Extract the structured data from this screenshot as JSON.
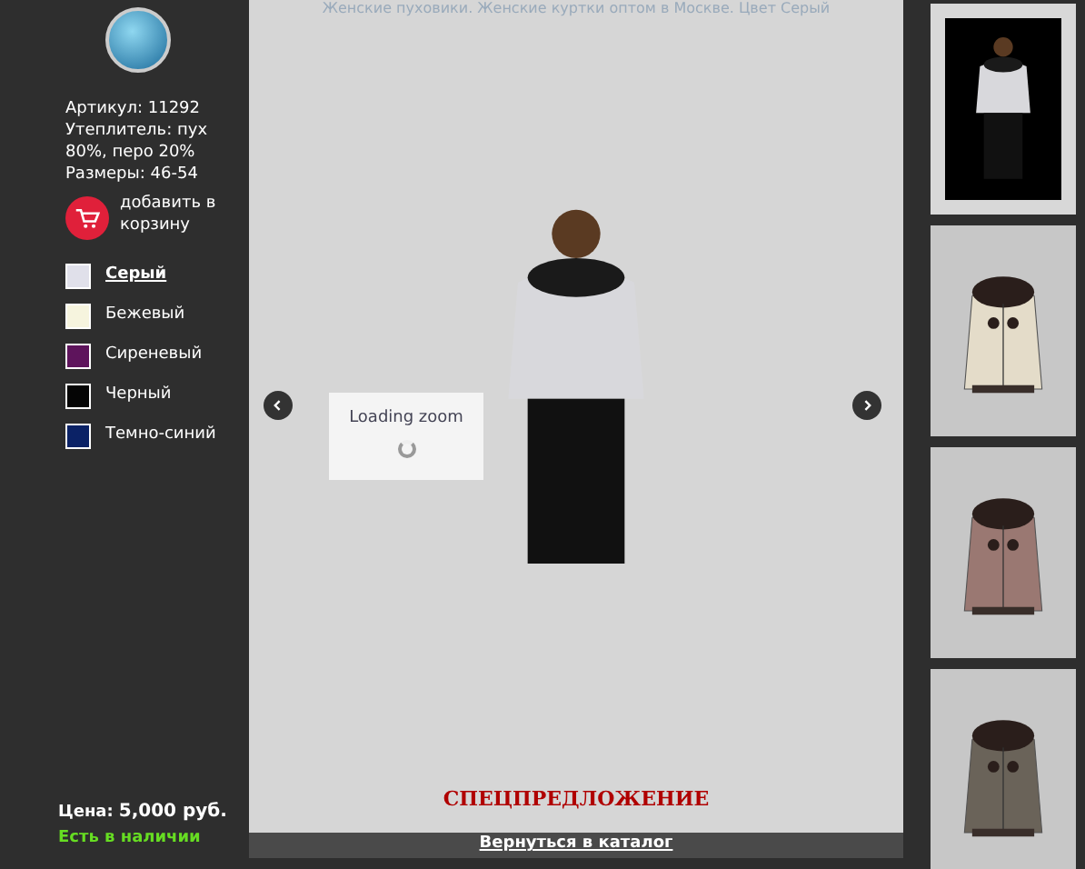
{
  "caption": "Женские пуховики. Женские куртки оптом в Москве. Цвет Серый",
  "product": {
    "article": "Артикул: 11292",
    "insulation": "Утеплитель: пух 80%, перо 20%",
    "sizes": "Размеры: 46-54",
    "cart_button": "добавить в корзину"
  },
  "colors": [
    {
      "label": "Серый",
      "color": "#e0e0ea",
      "selected": true
    },
    {
      "label": "Бежевый",
      "color": "#f6f4de",
      "selected": false
    },
    {
      "label": "Сиреневый",
      "color": "#5e145c",
      "selected": false
    },
    {
      "label": "Черный",
      "color": "#050505",
      "selected": false
    },
    {
      "label": "Темно-синий",
      "color": "#0b2266",
      "selected": false
    }
  ],
  "price_label": "Цена:",
  "price": "5,000 руб.",
  "availability": "Есть в наличии",
  "viewer": {
    "loading": "Loading zoom",
    "special_offer": "СПЕЦПРЕДЛОЖЕНИЕ",
    "back_link": "Вернуться в каталог"
  },
  "thumbnails": [
    {
      "kind": "model",
      "color": "#d8d8dc",
      "selected": true
    },
    {
      "kind": "jacket",
      "color": "#eee6d2",
      "selected": false
    },
    {
      "kind": "jacket",
      "color": "#a07c76",
      "selected": false
    },
    {
      "kind": "jacket",
      "color": "#6e665c",
      "selected": false
    }
  ]
}
